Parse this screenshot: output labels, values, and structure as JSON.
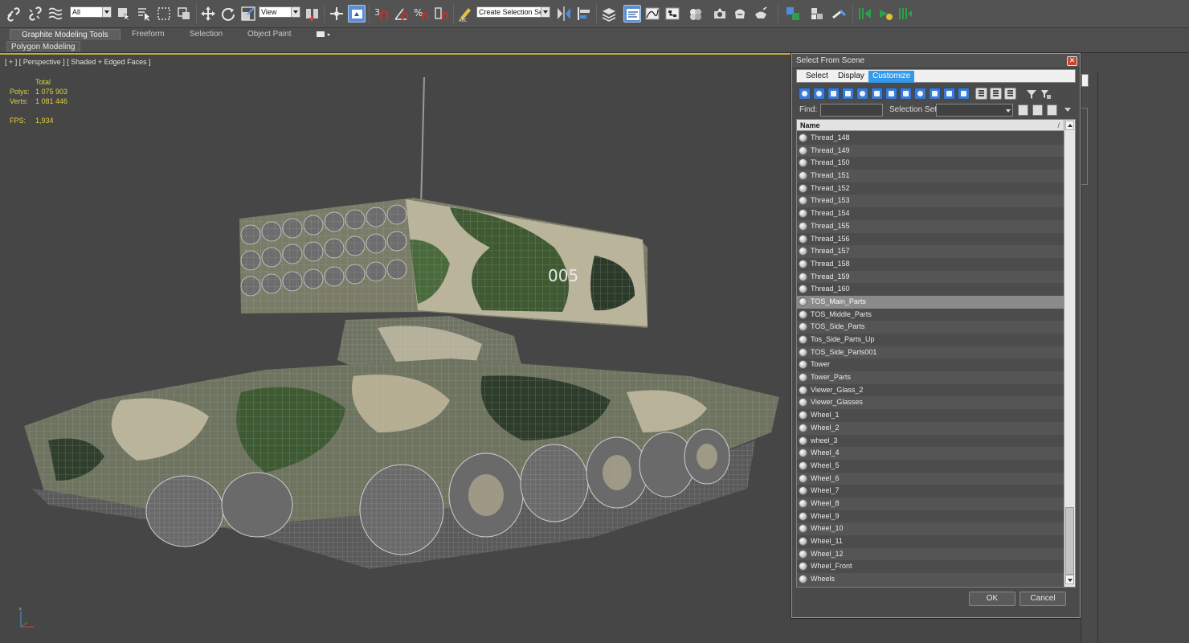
{
  "toolbar": {
    "selection_filter": "All",
    "reference_coord": "View",
    "named_selection_set": "Create Selection Se"
  },
  "ribbon": {
    "tabs": [
      "Graphite Modeling Tools",
      "Freeform",
      "Selection",
      "Object Paint"
    ],
    "active_tab": "Graphite Modeling Tools",
    "panel_label": "Polygon Modeling"
  },
  "viewport": {
    "label": "[ + ] [ Perspective ] [ Shaded + Edged Faces ]",
    "stats": {
      "total_label": "Total",
      "polys_label": "Polys:",
      "polys_value": "1 075 903",
      "verts_label": "Verts:",
      "verts_value": "1 081 446",
      "fps_label": "FPS:",
      "fps_value": "1,934"
    },
    "model_marking": "005"
  },
  "dialog": {
    "title": "Select From Scene",
    "menus": [
      "Select",
      "Display",
      "Customize"
    ],
    "active_menu": "Customize",
    "find_label": "Find:",
    "find_value": "",
    "selection_set_label": "Selection Set:",
    "column_header": "Name",
    "items": [
      "Thread_148",
      "Thread_149",
      "Thread_150",
      "Thread_151",
      "Thread_152",
      "Thread_153",
      "Thread_154",
      "Thread_155",
      "Thread_156",
      "Thread_157",
      "Thread_158",
      "Thread_159",
      "Thread_160",
      "TOS_Main_Parts",
      "TOS_Middle_Parts",
      "TOS_Side_Parts",
      "Tos_Side_Parts_Up",
      "TOS_Side_Parts001",
      "Tower",
      "Tower_Parts",
      "Viewer_Glass_2",
      "Viewer_Glasses",
      "Wheel_1",
      "Wheel_2",
      "wheel_3",
      "Wheel_4",
      "Wheel_5",
      "Wheel_6",
      "Wheel_7",
      "Wheel_8",
      "Wheel_9",
      "Wheel_10",
      "Wheel_11",
      "Wheel_12",
      "Wheel_Front",
      "Wheels"
    ],
    "selected_item": "TOS_Main_Parts",
    "ok_label": "OK",
    "cancel_label": "Cancel"
  },
  "colors": {
    "viewport_bg": "#464646",
    "stats_text": "#e0d040",
    "active_border": "#c8a83a",
    "menu_highlight": "#3399e8"
  }
}
